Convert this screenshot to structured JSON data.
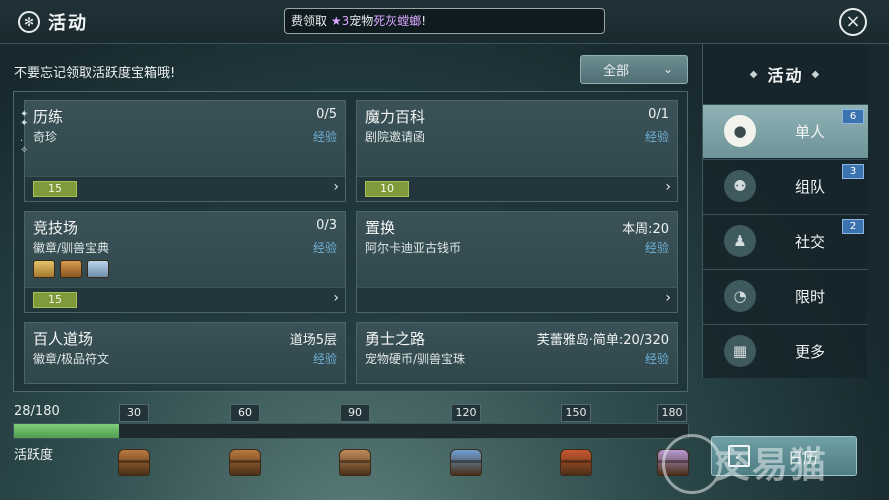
{
  "header": {
    "title": "活动",
    "ticker": {
      "prefix": "费领取 ",
      "star": "★3",
      "pet_prefix": "宠物",
      "pet_name": "死灰螳螂",
      "suffix": "!"
    }
  },
  "reminder": "不要忘记领取活跃度宝箱哦!",
  "filter": {
    "selected": "全部"
  },
  "cards": [
    {
      "name": "历练",
      "count": "0/5",
      "reward": "奇珍",
      "xp": "经验",
      "level": "15"
    },
    {
      "name": "魔力百科",
      "count": "0/1",
      "reward": "剧院邀请函",
      "xp": "经验",
      "level": "10"
    },
    {
      "name": "竞技场",
      "count": "0/3",
      "reward": "徽章/驯兽宝典",
      "xp": "经验",
      "level": "15"
    },
    {
      "name": "置换",
      "count": "本周:20",
      "reward": "阿尔卡迪亚古钱币",
      "xp": "经验",
      "level": ""
    },
    {
      "name": "百人道场",
      "count": "道场5层",
      "reward": "徽章/极品符文",
      "xp": "经验"
    },
    {
      "name": "勇士之路",
      "count": "芙蕾雅岛·简单:20/320",
      "reward": "宠物硬币/驯兽宝珠",
      "xp": "经验"
    }
  ],
  "progress": {
    "current_label": "28/180",
    "value": 28,
    "max": 180,
    "label": "活跃度",
    "milestones": [
      "30",
      "60",
      "90",
      "120",
      "150",
      "180"
    ],
    "chest_colors": [
      "#b9793f",
      "#b9793f",
      "#c08a5a",
      "#6f9fd6",
      "#c9582f",
      "#b79bd6"
    ]
  },
  "side": {
    "title": "活动",
    "tabs": [
      {
        "label": "单人",
        "badge": "6",
        "icon": "person-icon",
        "active": true
      },
      {
        "label": "组队",
        "badge": "3",
        "icon": "team-icon"
      },
      {
        "label": "社交",
        "badge": "2",
        "icon": "social-icon"
      },
      {
        "label": "限时",
        "badge": "",
        "icon": "clock-icon"
      },
      {
        "label": "更多",
        "badge": "",
        "icon": "grid-icon"
      }
    ]
  },
  "calendar": {
    "label": "日历"
  },
  "watermark": "交易猫",
  "icons": {
    "title": "activity-icon",
    "close": "close-icon",
    "calendar": "calendar-icon"
  }
}
